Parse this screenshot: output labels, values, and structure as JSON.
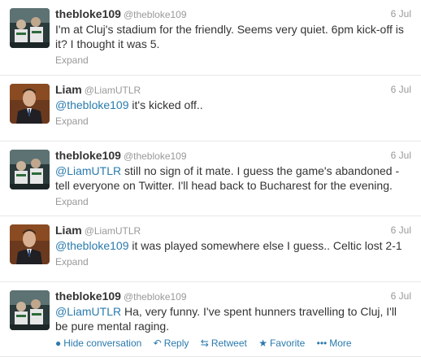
{
  "tweets": [
    {
      "fullname": "thebloke109",
      "username": "@thebloke109",
      "date": "6 Jul",
      "mention": "",
      "text": "I'm at Cluj's stadium for the friendly. Seems very quiet. 6pm kick-off is it? I thought it was 5.",
      "expand": "Expand",
      "avatar": "group-photo-avatar"
    },
    {
      "fullname": "Liam",
      "username": "@LiamUTLR",
      "date": "6 Jul",
      "mention": "@thebloke109",
      "text": " it's kicked off..",
      "expand": "Expand",
      "avatar": "man-in-suit-avatar"
    },
    {
      "fullname": "thebloke109",
      "username": "@thebloke109",
      "date": "6 Jul",
      "mention": "@LiamUTLR",
      "text": " still no sign of it mate. I guess the game's abandoned - tell everyone on Twitter. I'll head back to Bucharest for the evening.",
      "expand": "Expand",
      "avatar": "group-photo-avatar"
    },
    {
      "fullname": "Liam",
      "username": "@LiamUTLR",
      "date": "6 Jul",
      "mention": "@thebloke109",
      "text": " it was played somewhere else I guess.. Celtic lost 2-1",
      "expand": "Expand",
      "avatar": "man-in-suit-avatar"
    },
    {
      "fullname": "thebloke109",
      "username": "@thebloke109",
      "date": "6 Jul",
      "mention": "@LiamUTLR",
      "text": " Ha, very funny. I've spent hunners travelling to Cluj, I'll be pure mental raging.",
      "avatar": "group-photo-avatar"
    }
  ],
  "actions": {
    "hide": "Hide conversation",
    "reply": "Reply",
    "retweet": "Retweet",
    "favorite": "Favorite",
    "more": "More"
  },
  "colors": {
    "link": "#2a7aad",
    "muted": "#999999",
    "text": "#333333"
  }
}
